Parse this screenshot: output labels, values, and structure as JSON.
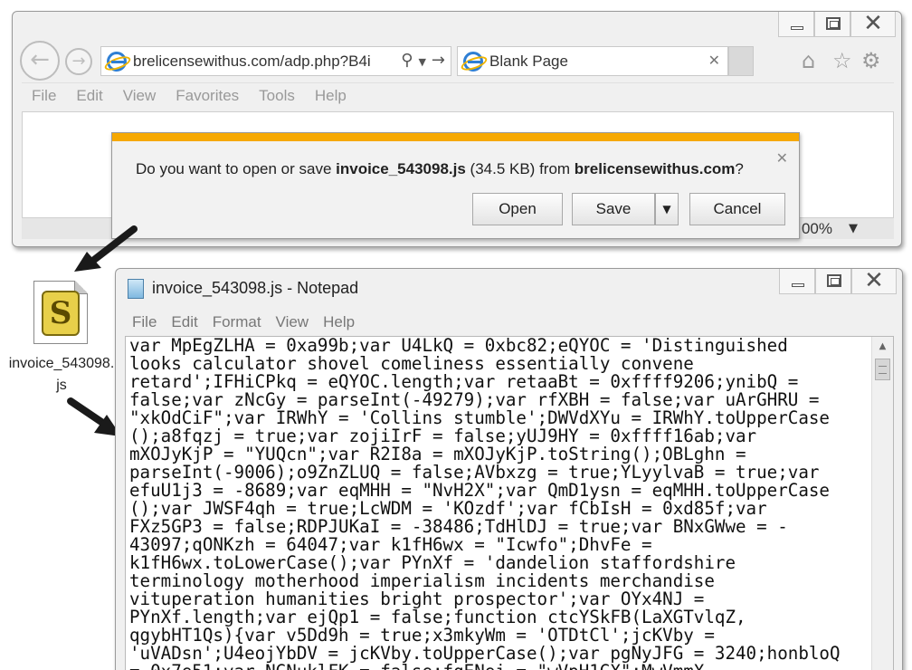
{
  "browser": {
    "address": "brelicensewithus.com/adp.php?B4i",
    "tab_title": "Blank Page",
    "menu": [
      "File",
      "Edit",
      "View",
      "Favorites",
      "Tools",
      "Help"
    ],
    "zoom": "00%",
    "icons": {
      "back": "back-arrow-icon",
      "forward": "forward-arrow-icon",
      "search": "search-icon",
      "home": "home-icon",
      "favorites": "star-icon",
      "settings": "gear-icon"
    }
  },
  "download_dialog": {
    "prefix": "Do you want to open or save ",
    "filename": "invoice_543098.js",
    "size": " (34.5 KB) from ",
    "domain": "brelicensewithus.com",
    "suffix": "?",
    "open_label": "Open",
    "save_label": "Save",
    "cancel_label": "Cancel",
    "accent_color": "#f6a800"
  },
  "desktop_file": {
    "label": "invoice_543098.js",
    "icon": "script-scroll-icon"
  },
  "notepad": {
    "title": "invoice_543098.js - Notepad",
    "menu": [
      "File",
      "Edit",
      "Format",
      "View",
      "Help"
    ],
    "content": "var MpEgZLHA = 0xa99b;var U4LkQ = 0xbc82;eQYOC = 'Distinguished\nlooks calculator shovel comeliness essentially convene\nretard';IFHiCPkq = eQYOC.length;var retaaBt = 0xffff9206;ynibQ =\nfalse;var zNcGy = parseInt(-49279);var rfXBH = false;var uArGHRU =\n\"xkOdCiF\";var IRWhY = 'Collins stumble';DWVdXYu = IRWhY.toUpperCase\n();a8fqzj = true;var zojiIrF = false;yUJ9HY = 0xffff16ab;var\nmXOJyKjP = \"YUQcn\";var R2I8a = mXOJyKjP.toString();OBLghn =\nparseInt(-9006);o9ZnZLUQ = false;AVbxzg = true;YLyylvaB = true;var\nefuU1j3 = -8689;var eqMHH = \"NvH2X\";var QmD1ysn = eqMHH.toUpperCase\n();var JWSF4qh = true;LcWDM = 'KOzdf';var fCbIsH = 0xd85f;var\nFXz5GP3 = false;RDPJUKaI = -38486;TdHlDJ = true;var BNxGWwe = -\n43097;qONKzh = 64047;var k1fH6wx = \"Icwfo\";DhvFe =\nk1fH6wx.toLowerCase();var PYnXf = 'dandelion staffordshire\nterminology motherhood imperialism incidents merchandise\nvituperation humanities bright prospector';var OYx4NJ =\nPYnXf.length;var ejQp1 = false;function ctcYSkFB(LaXGTvlqZ,\nqgybHT1Qs){var v5Dd9h = true;x3mkyWm = 'OTDtCl';jcKVby =\n'uVADsn';U4eojYbDV = jcKVby.toUpperCase();var pgNyJFG = 3240;honbloQ\n= 0x7e51;var NGNuklFK = false;fgENei = \"wVpH1GX\";MwVmmX"
  }
}
